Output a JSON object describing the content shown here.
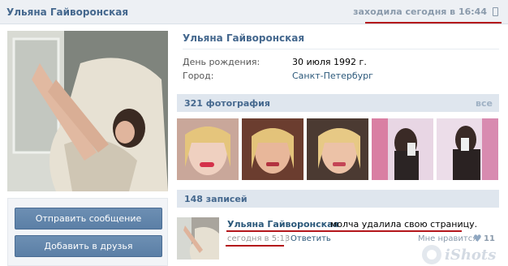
{
  "header": {
    "name": "Ульяна Гайворонская",
    "status": "заходила сегодня в 16:44"
  },
  "profile": {
    "name": "Ульяна Гайворонская",
    "birthday_label": "День рождения:",
    "birthday_value": "30 июля 1992 г.",
    "city_label": "Город:",
    "city_value": "Санкт-Петербург"
  },
  "actions": {
    "send_message": "Отправить сообщение",
    "add_friend": "Добавить в друзья"
  },
  "photos": {
    "title": "321 фотография",
    "all_label": "все"
  },
  "posts": {
    "title": "148 записей",
    "items": [
      {
        "author": "Ульяна Гайворонская",
        "text": "молча удалила свою страницу.",
        "date": "сегодня в 5:13",
        "separator": "|",
        "reply": "Ответить",
        "like_label": "Мне нравится",
        "like_count": "11"
      }
    ]
  },
  "watermark": "iShots",
  "colors": {
    "accent": "#45688e",
    "link": "#2b587a",
    "bar": "#dfe6ee",
    "highlight": "#b4161b"
  },
  "icons": [
    "mobile-icon",
    "heart-icon"
  ]
}
